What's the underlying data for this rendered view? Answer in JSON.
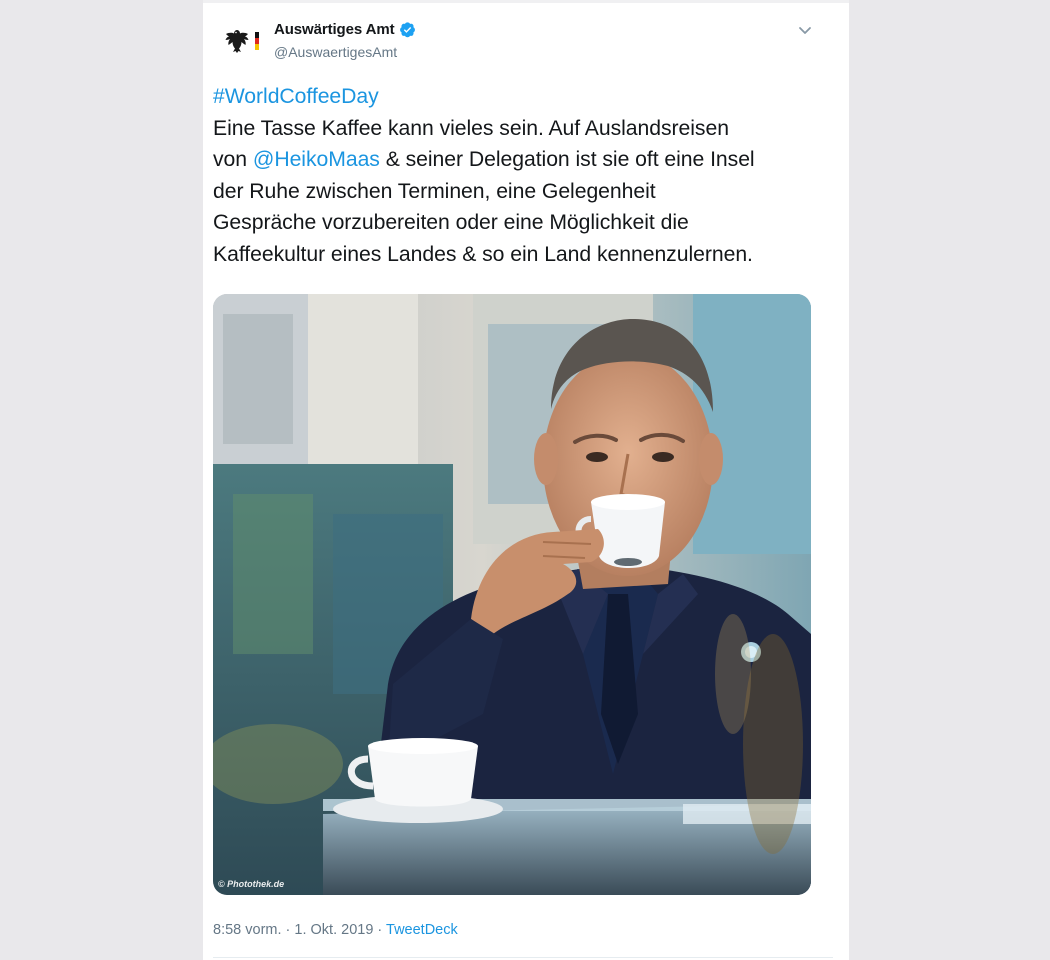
{
  "account": {
    "name": "Auswärtiges Amt",
    "handle": "@AuswaertigesAmt"
  },
  "tweet": {
    "hashtag": "#WorldCoffeeDay",
    "line1": "Eine Tasse Kaffee kann vieles sein. Auf Auslandsreisen",
    "line2_prefix": "von ",
    "mention": "@HeikoMaas",
    "line2_suffix": " & seiner Delegation ist sie oft eine Insel",
    "line3": "der Ruhe zwischen Terminen, eine Gelegenheit",
    "line4": "Gespräche vorzubereiten oder eine Möglichkeit die",
    "line5": "Kaffeekultur eines Landes & so ein Land kennenzulernen."
  },
  "photo": {
    "credit": "© Photothek.de"
  },
  "meta": {
    "time": "8:58 vorm.",
    "separator": " · ",
    "date": "1. Okt. 2019",
    "separator2": " · ",
    "source": "TweetDeck"
  },
  "colors": {
    "link": "#1b95e0",
    "text": "#14171a",
    "muted": "#657786",
    "verified": "#1da1f2"
  },
  "icons": {
    "logo": "federal-eagle-with-flag-icon",
    "verified": "verified-badge-icon",
    "menu": "chevron-down-icon"
  }
}
